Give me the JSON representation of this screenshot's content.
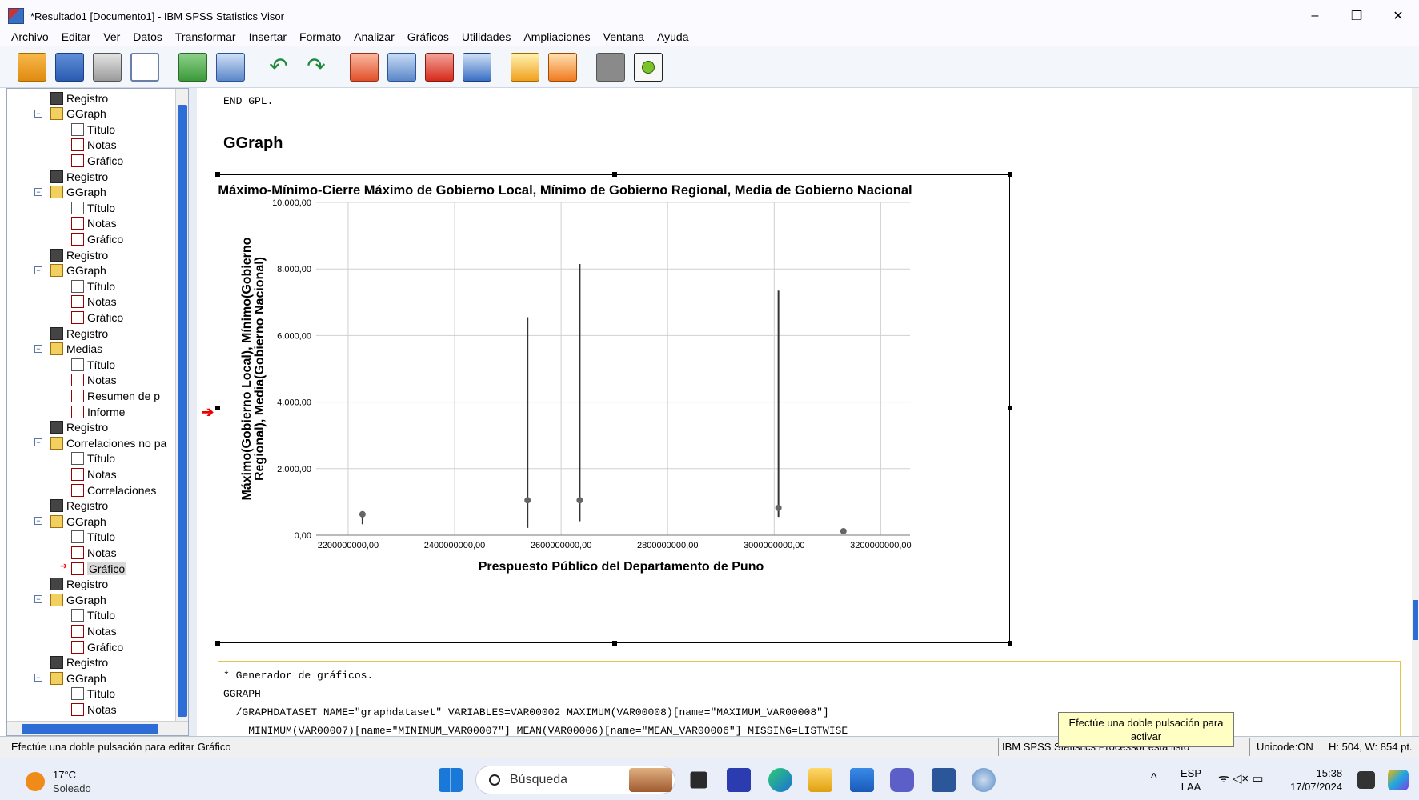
{
  "window": {
    "title": "*Resultado1 [Documento1] - IBM SPSS Statistics Visor",
    "minimize": "–",
    "restore": "❐",
    "close": "✕"
  },
  "menu": [
    "Archivo",
    "Editar",
    "Ver",
    "Datos",
    "Transformar",
    "Insertar",
    "Formato",
    "Analizar",
    "Gráficos",
    "Utilidades",
    "Ampliaciones",
    "Ventana",
    "Ayuda"
  ],
  "navigator": {
    "items": [
      {
        "label": "Registro",
        "type": "book",
        "level": 1
      },
      {
        "label": "GGraph",
        "type": "folder",
        "level": 1,
        "expand": "−"
      },
      {
        "label": "Título",
        "type": "doc",
        "level": 2
      },
      {
        "label": "Notas",
        "type": "notes",
        "level": 2
      },
      {
        "label": "Gráfico",
        "type": "chart",
        "level": 2
      },
      {
        "label": "Registro",
        "type": "book",
        "level": 1
      },
      {
        "label": "GGraph",
        "type": "folder",
        "level": 1,
        "expand": "−"
      },
      {
        "label": "Título",
        "type": "doc",
        "level": 2
      },
      {
        "label": "Notas",
        "type": "notes",
        "level": 2
      },
      {
        "label": "Gráfico",
        "type": "chart",
        "level": 2
      },
      {
        "label": "Registro",
        "type": "book",
        "level": 1
      },
      {
        "label": "GGraph",
        "type": "folder",
        "level": 1,
        "expand": "−"
      },
      {
        "label": "Título",
        "type": "doc",
        "level": 2
      },
      {
        "label": "Notas",
        "type": "notes",
        "level": 2
      },
      {
        "label": "Gráfico",
        "type": "chart",
        "level": 2
      },
      {
        "label": "Registro",
        "type": "book",
        "level": 1
      },
      {
        "label": "Medias",
        "type": "folder",
        "level": 1,
        "expand": "−"
      },
      {
        "label": "Título",
        "type": "doc",
        "level": 2
      },
      {
        "label": "Notas",
        "type": "notes",
        "level": 2
      },
      {
        "label": "Resumen de p",
        "type": "chart",
        "level": 2
      },
      {
        "label": "Informe",
        "type": "chart",
        "level": 2
      },
      {
        "label": "Registro",
        "type": "book",
        "level": 1
      },
      {
        "label": "Correlaciones no pa",
        "type": "folder",
        "level": 1,
        "expand": "−"
      },
      {
        "label": "Título",
        "type": "doc",
        "level": 2
      },
      {
        "label": "Notas",
        "type": "notes",
        "level": 2
      },
      {
        "label": "Correlaciones",
        "type": "chart",
        "level": 2
      },
      {
        "label": "Registro",
        "type": "book",
        "level": 1
      },
      {
        "label": "GGraph",
        "type": "folder",
        "level": 1,
        "expand": "−"
      },
      {
        "label": "Título",
        "type": "doc",
        "level": 2
      },
      {
        "label": "Notas",
        "type": "notes",
        "level": 2
      },
      {
        "label": "Gráfico",
        "type": "chart",
        "level": 2,
        "selected": true
      },
      {
        "label": "Registro",
        "type": "book",
        "level": 1
      },
      {
        "label": "GGraph",
        "type": "folder",
        "level": 1,
        "expand": "−"
      },
      {
        "label": "Título",
        "type": "doc",
        "level": 2
      },
      {
        "label": "Notas",
        "type": "notes",
        "level": 2
      },
      {
        "label": "Gráfico",
        "type": "chart",
        "level": 2
      },
      {
        "label": "Registro",
        "type": "book",
        "level": 1
      },
      {
        "label": "GGraph",
        "type": "folder",
        "level": 1,
        "expand": "−"
      },
      {
        "label": "Título",
        "type": "doc",
        "level": 2
      },
      {
        "label": "Notas",
        "type": "notes",
        "level": 2
      }
    ]
  },
  "output": {
    "gpl_end": "END GPL.",
    "section_title": "GGraph",
    "syntax_lines": [
      "* Generador de gráficos.",
      "GGRAPH",
      "  /GRAPHDATASET NAME=\"graphdataset\" VARIABLES=VAR00002 MAXIMUM(VAR00008)[name=\"MAXIMUM_VAR00008\"]",
      "    MINIMUM(VAR00007)[name=\"MINIMUM_VAR00007\"] MEAN(VAR00006)[name=\"MEAN_VAR00006\"] MISSING=LISTWISE"
    ],
    "marker_arrow": "➔"
  },
  "chart_data": {
    "type": "scatter",
    "title": "Máximo-Mínimo-Cierre Máximo de Gobierno Local, Mínimo de Gobierno Regional, Media de Gobierno Nacional",
    "xlabel": "Prespuesto Público del Departamento de Puno",
    "ylabel": "Máximo(Gobierno Local), Mínimo(Gobierno Regional), Media(Gobierno Nacional)",
    "xlim": [
      2140000000,
      3255000000
    ],
    "ylim": [
      0,
      10000
    ],
    "x_ticks": [
      2200000000,
      2400000000,
      2600000000,
      2800000000,
      3000000000,
      3200000000
    ],
    "x_tick_labels": [
      "2200000000,00",
      "2400000000,00",
      "2600000000,00",
      "2800000000,00",
      "3000000000,00",
      "3200000000,00"
    ],
    "y_ticks": [
      0,
      2000,
      4000,
      6000,
      8000,
      10000
    ],
    "y_tick_labels": [
      "0,00",
      "2.000,00",
      "4.000,00",
      "6.000,00",
      "8.000,00",
      "10.000,00"
    ],
    "grid": true,
    "series": [
      {
        "name": "Máximo(Gobierno Local)",
        "values": [
          580,
          6550,
          8150,
          7350,
          100
        ]
      },
      {
        "name": "Mínimo(Gobierno Regional)",
        "values": [
          330,
          220,
          420,
          550,
          100
        ]
      },
      {
        "name": "Media(Gobierno Nacional)",
        "values": [
          630,
          1050,
          1050,
          820,
          120
        ]
      }
    ],
    "x": [
      2227000000,
      2537000000,
      2635000000,
      3008000000,
      3130000000
    ]
  },
  "statusbar": {
    "left": "Efectúe una doble pulsación para editar Gráfico",
    "processor": "IBM SPSS Statistics Processor está listo",
    "unicode": "Unicode:ON",
    "size": "H: 504, W: 854 pt."
  },
  "tooltip": "Efectúe una doble pulsación para activar",
  "taskbar": {
    "temp": "17°C",
    "weather": "Soleado",
    "search": "Búsqueda",
    "lang1": "ESP",
    "lang2": "LAA",
    "time": "15:38",
    "date": "17/07/2024",
    "chevron": "^",
    "tray_icons": "ᯤ ◁× ▭"
  }
}
